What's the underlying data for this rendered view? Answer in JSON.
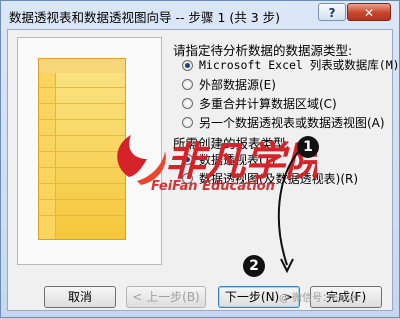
{
  "window": {
    "title": "数据透视表和数据透视图向导 -- 步骤 1 (共 3 步)",
    "help_label": "?",
    "close_label": "✕"
  },
  "source_group": {
    "label": "请指定待分析数据的数据源类型:",
    "options": [
      {
        "label": "Microsoft Excel 列表或数据库(M)",
        "checked": true
      },
      {
        "label": "外部数据源(E)",
        "checked": false
      },
      {
        "label": "多重合并计算数据区域(C)",
        "checked": false
      },
      {
        "label": "另一个数据透视表或数据透视图(A)",
        "checked": false
      }
    ]
  },
  "report_group": {
    "label": "所需创建的报表类型:",
    "options": [
      {
        "label": "数据透视表(T)",
        "checked": true
      },
      {
        "label": "数据透视图(及数据透视表)(R)",
        "checked": false
      }
    ]
  },
  "buttons": {
    "cancel": "取消",
    "back": "< 上一步(B)",
    "next": "下一步(N) >",
    "finish": "完成(F)"
  },
  "annotations": {
    "step1": "1",
    "step2": "2"
  },
  "watermark": {
    "logo_text": "非凡学院",
    "subtitle": "FeiFan Education",
    "corner_text": "@ 微信号：Excel"
  },
  "colors": {
    "sheet_fill": "#f5c73a",
    "watermark_red": "#d4242a",
    "selected_radio": "#1f3f7a"
  }
}
